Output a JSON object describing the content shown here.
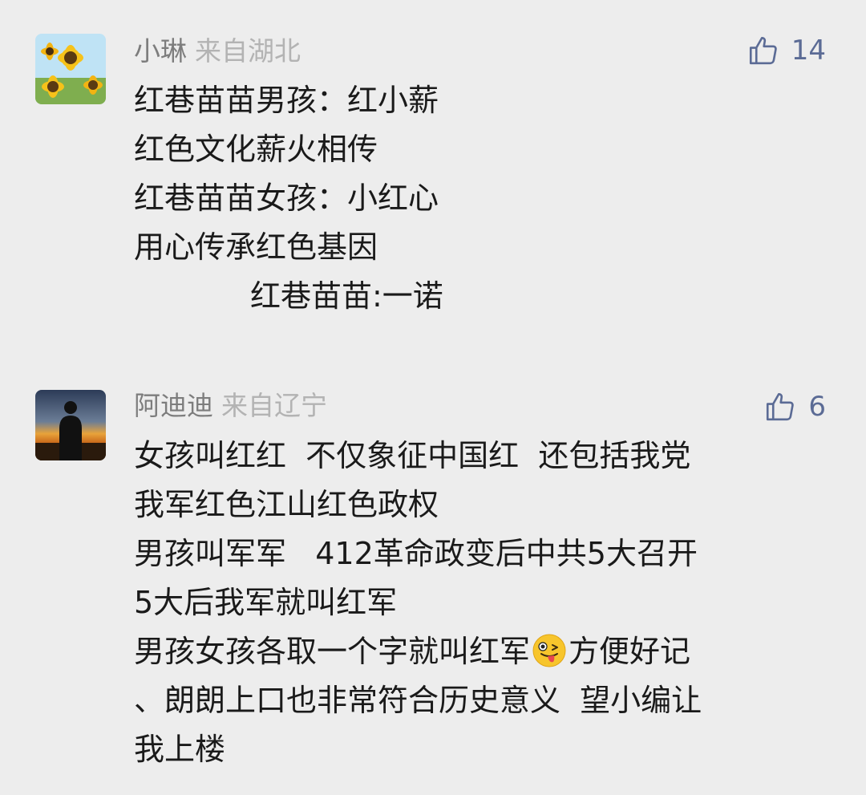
{
  "comments": [
    {
      "nickname": "小琳",
      "location": "来自湖北",
      "likes": "14",
      "avatar_icon": "sunflower-avatar-icon",
      "lines": [
        "红巷苗苗男孩：红小薪",
        "红色文化薪火相传",
        "红巷苗苗女孩：小红心",
        "用心传承红色基因",
        "            红巷苗苗:一诺"
      ]
    },
    {
      "nickname": "阿迪迪",
      "location": "来自辽宁",
      "likes": "6",
      "avatar_icon": "sunset-silhouette-avatar-icon",
      "lines": [
        "女孩叫红红  不仅象征中国红  还包括我党",
        "我军红色江山红色政权",
        "男孩叫军军   412革命政变后中共5大召开",
        "5大后我军就叫红军"
      ],
      "line_with_emoji": {
        "before": "男孩女孩各取一个字就叫红军",
        "emoji_icon": "winking-tongue-emoji-icon",
        "after": "方便好记"
      },
      "lines_after": [
        "、朗朗上口也非常符合历史意义  望小编让",
        "我上楼"
      ]
    }
  ],
  "colors": {
    "background": "#ededed",
    "nickname": "#7d7d7d",
    "location": "#b3b3b3",
    "like_accent": "#5b6b95",
    "text": "#1a1a1a"
  }
}
